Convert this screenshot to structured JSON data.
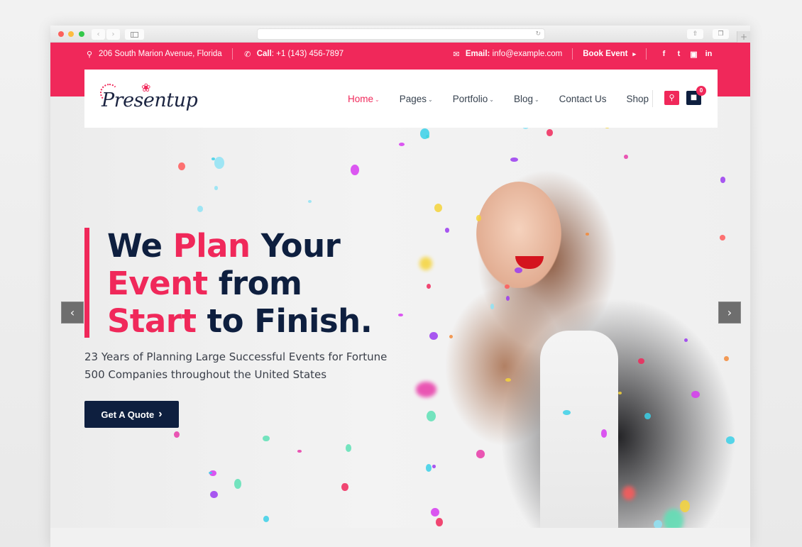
{
  "browser": {
    "back_icon": "‹",
    "forward_icon": "›",
    "reload_icon": "↻",
    "share_icon": "⇧",
    "tabs_icon": "❐",
    "new_tab_icon": "+"
  },
  "topbar": {
    "address": "206 South Marion Avenue, Florida",
    "call_label": "Call",
    "call_value": ": +1 (143) 456-7897",
    "email_label": "Email:",
    "email_value": " info@example.com",
    "book_event": "Book Event",
    "icons": {
      "location": "⚲",
      "phone": "✆",
      "email": "✉",
      "book_arrow": "▸"
    },
    "social": [
      "f",
      "t",
      "▣",
      "in"
    ]
  },
  "header": {
    "logo_text": "Presentup",
    "menu": [
      {
        "label": "Home",
        "dropdown": true,
        "active": true
      },
      {
        "label": "Pages",
        "dropdown": true,
        "active": false
      },
      {
        "label": "Portfolio",
        "dropdown": true,
        "active": false
      },
      {
        "label": "Blog",
        "dropdown": true,
        "active": false
      },
      {
        "label": "Contact Us",
        "dropdown": false,
        "active": false
      },
      {
        "label": "Shop",
        "dropdown": false,
        "active": false
      }
    ],
    "caret": "⌄",
    "cart_count": "0",
    "search_icon": "⚲",
    "cart_icon": "🛒"
  },
  "hero": {
    "title_line1_a": "We ",
    "title_line1_b": "Plan",
    "title_line1_c": " Your",
    "title_line2_a": "Event",
    "title_line2_b": " from",
    "title_line3_a": "Start",
    "title_line3_b": " to Finish.",
    "subtitle": "23 Years of Planning Large Successful Events for Fortune 500 Companies throughout the United States",
    "cta_label": "Get A Quote",
    "cta_icon": "›",
    "prev_icon": "‹",
    "next_icon": "›"
  },
  "colors": {
    "accent": "#f0285a",
    "navy": "#0e1f3f"
  }
}
